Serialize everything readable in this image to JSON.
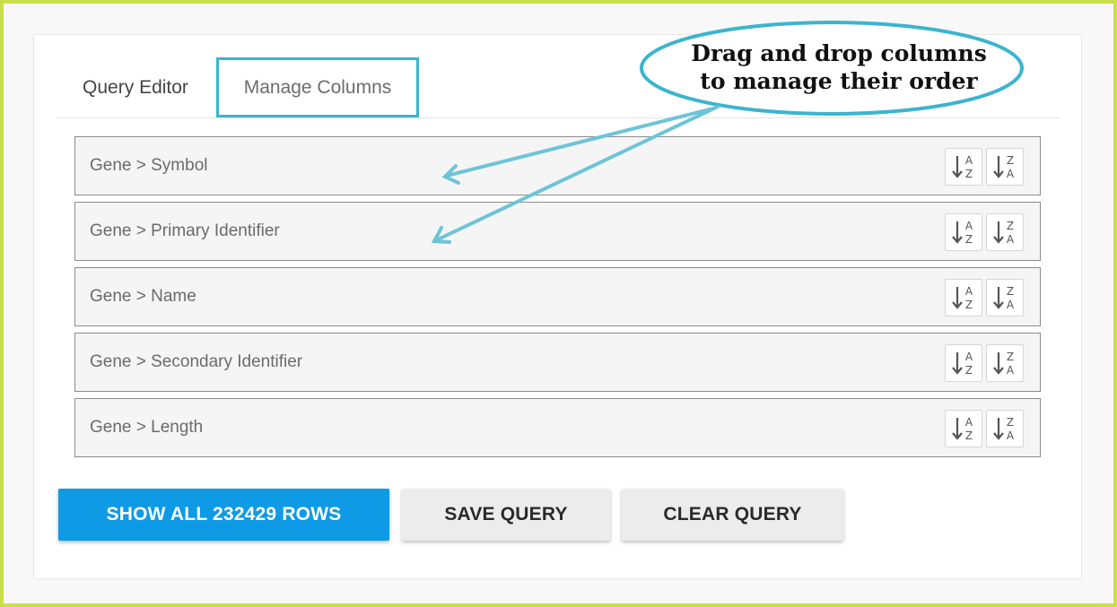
{
  "tabs": [
    {
      "label": "Query Editor"
    },
    {
      "label": "Manage Columns"
    }
  ],
  "columns": [
    {
      "label": "Gene > Symbol"
    },
    {
      "label": "Gene > Primary Identifier"
    },
    {
      "label": "Gene > Name"
    },
    {
      "label": "Gene > Secondary Identifier"
    },
    {
      "label": "Gene > Length"
    }
  ],
  "sort_icons": {
    "asc": "sort-ascending-icon",
    "desc": "sort-descending-icon",
    "asc_letters": [
      "A",
      "Z"
    ],
    "desc_letters": [
      "Z",
      "A"
    ]
  },
  "buttons": {
    "show_all": "SHOW ALL 232429 ROWS",
    "save": "SAVE QUERY",
    "clear": "CLEAR QUERY"
  },
  "callout": {
    "line1": "Drag and drop columns",
    "line2": "to manage their order"
  },
  "colors": {
    "accent": "#3cb4cf",
    "primary_button": "#0f9ae6",
    "frame": "#c9e04a"
  }
}
